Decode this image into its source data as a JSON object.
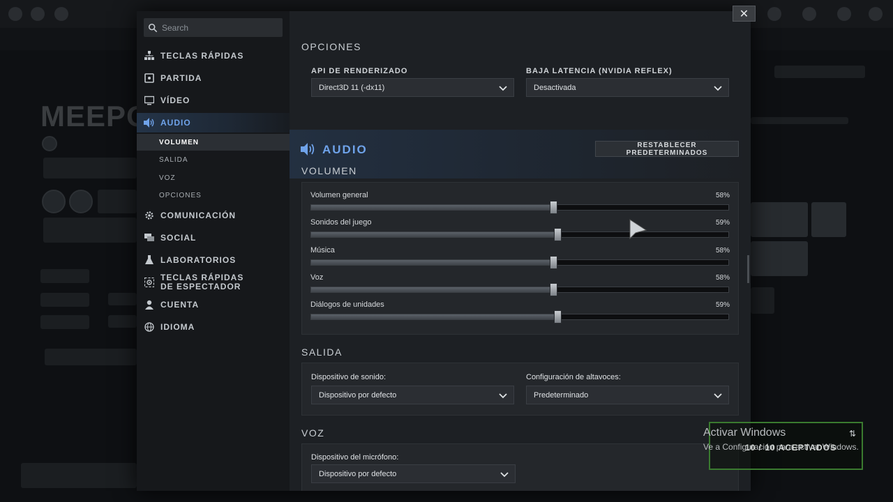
{
  "background": {
    "hero_name": "MEEPO"
  },
  "search": {
    "placeholder": "Search"
  },
  "nav": {
    "items": [
      {
        "label": "TECLAS RÁPIDAS",
        "icon": "sitemap-icon"
      },
      {
        "label": "PARTIDA",
        "icon": "gamepad-icon"
      },
      {
        "label": "VÍDEO",
        "icon": "monitor-icon"
      },
      {
        "label": "AUDIO",
        "icon": "speaker-icon",
        "active": true
      },
      {
        "label": "COMUNICACIÓN",
        "icon": "gear-icon"
      },
      {
        "label": "SOCIAL",
        "icon": "chat-icon"
      },
      {
        "label": "LABORATORIOS",
        "icon": "flask-icon"
      },
      {
        "label": "TECLAS RÁPIDAS DE ESPECTADOR",
        "icon": "spectator-icon"
      },
      {
        "label": "CUENTA",
        "icon": "user-icon"
      },
      {
        "label": "IDIOMA",
        "icon": "globe-icon"
      }
    ],
    "audio_sub": [
      "VOLUMEN",
      "SALIDA",
      "VOZ",
      "OPCIONES"
    ]
  },
  "options": {
    "title": "OPCIONES",
    "api_label": "API DE RENDERIZADO",
    "api_value": "Direct3D 11 (-dx11)",
    "latency_label": "BAJA LATENCIA (NVIDIA REFLEX)",
    "latency_value": "Desactivada"
  },
  "audio": {
    "title": "AUDIO",
    "reset_label": "RESTABLECER PREDETERMINADOS",
    "volume_title": "VOLUMEN",
    "sliders": [
      {
        "label": "Volumen general",
        "value": 58,
        "display": "58%"
      },
      {
        "label": "Sonidos del juego",
        "value": 59,
        "display": "59%"
      },
      {
        "label": "Música",
        "value": 58,
        "display": "58%"
      },
      {
        "label": "Voz",
        "value": 58,
        "display": "58%"
      },
      {
        "label": "Diálogos de unidades",
        "value": 59,
        "display": "59%"
      }
    ]
  },
  "output": {
    "title": "SALIDA",
    "device_label": "Dispositivo de sonido:",
    "device_value": "Dispositivo por defecto",
    "speakers_label": "Configuración de altavoces:",
    "speakers_value": "Predeterminado"
  },
  "voice": {
    "title": "VOZ",
    "mic_label": "Dispositivo del micrófono:",
    "mic_value": "Dispositivo por defecto"
  },
  "close_label": "✕",
  "windows": {
    "line1": "Activar Windows",
    "line2": "Ve a Configuración para activar Windows."
  },
  "toast": {
    "count": "10 / 10 ACEPTADOS",
    "swap": "⇅"
  },
  "colors": {
    "accent": "#6fa3ea",
    "toast_border": "#3a7a2f"
  }
}
